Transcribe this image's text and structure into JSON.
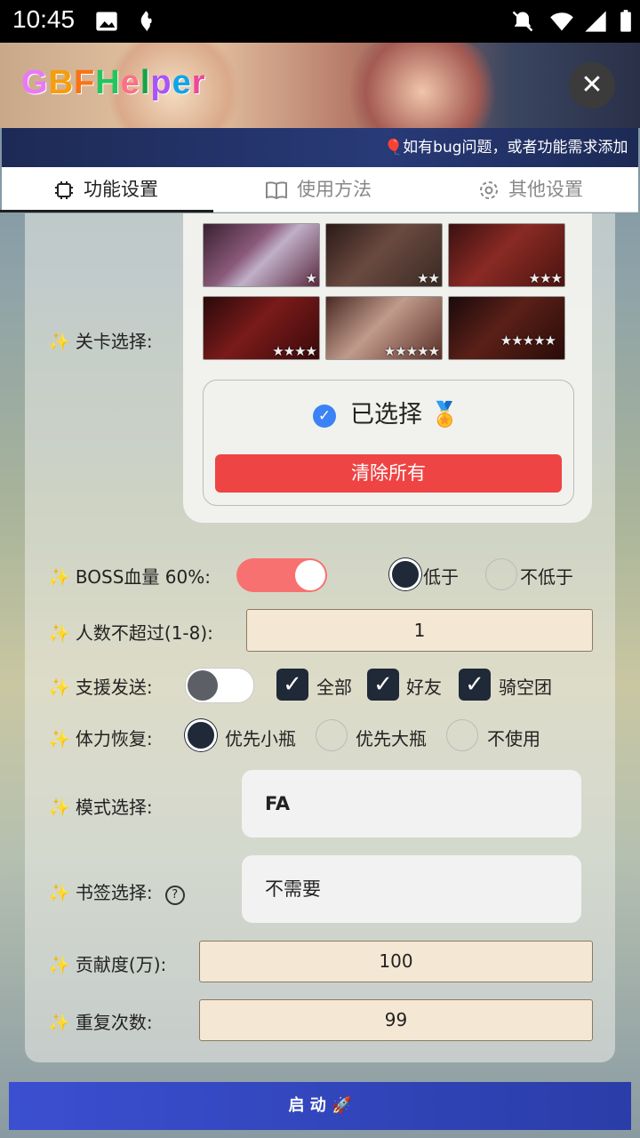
{
  "status": {
    "time": "10:45"
  },
  "header": {
    "logo_letters": [
      "G",
      "B",
      "F",
      "H",
      "e",
      "l",
      "p",
      "e",
      "r"
    ],
    "logo_colors": [
      "#e879f9",
      "#f59e0b",
      "#f97316",
      "#22c55e",
      "#fb7185",
      "#16a34a",
      "#a855f7",
      "#0ea5e9",
      "#ec4899"
    ],
    "close": "✕"
  },
  "marquee": {
    "text": "🎈如有bug问题，或者功能需求添加"
  },
  "tabs": [
    {
      "label": "功能设置"
    },
    {
      "label": "使用方法"
    },
    {
      "label": "其他设置"
    }
  ],
  "stage": {
    "label": "关卡选择:",
    "items": [
      {
        "stars": "★"
      },
      {
        "stars": "★★"
      },
      {
        "stars": "★★★"
      },
      {
        "stars": "★★★★"
      },
      {
        "stars": "★★★★★"
      },
      {
        "stars": "★★★★★"
      }
    ],
    "selected_label": "已选择",
    "selected_emoji": "🏅",
    "clear_label": "清除所有"
  },
  "boss": {
    "label": "BOSS血量 60%:",
    "opt1": "低于",
    "opt2": "不低于"
  },
  "players": {
    "label": "人数不超过(1-8):",
    "value": "1"
  },
  "support": {
    "label": "支援发送:",
    "opt1": "全部",
    "opt2": "好友",
    "opt3": "骑空团"
  },
  "stamina": {
    "label": "体力恢复:",
    "opt1": "优先小瓶",
    "opt2": "优先大瓶",
    "opt3": "不使用"
  },
  "mode": {
    "label": "模式选择:",
    "value": "FA"
  },
  "bookmark": {
    "label": "书签选择:",
    "value": "不需要"
  },
  "contribution": {
    "label": "贡献度(万):",
    "value": "100"
  },
  "repeat": {
    "label": "重复次数:",
    "value": "99"
  },
  "start": {
    "label": "启 动 🚀"
  },
  "sparkle": "✨"
}
